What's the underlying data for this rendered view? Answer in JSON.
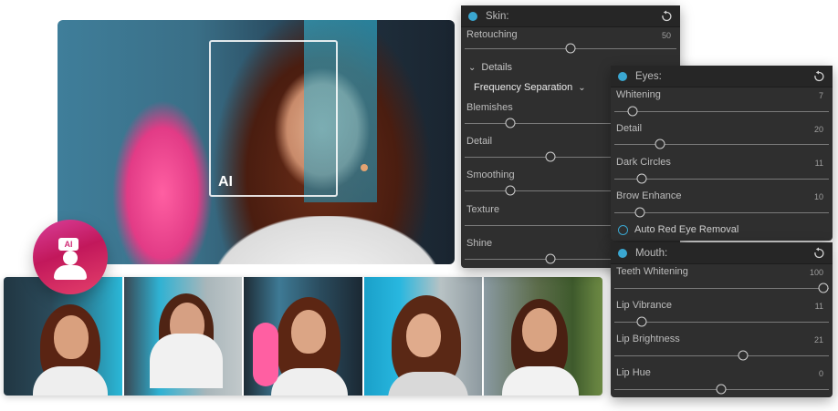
{
  "main_photo": {
    "ai_label": "AI"
  },
  "badge": {
    "tag": "AI"
  },
  "skin_panel": {
    "title": "Skin:",
    "rows_top": [
      {
        "label": "Retouching",
        "value": "50",
        "fraction": 0.47
      }
    ],
    "details_label": "Details",
    "frequency_select": "Frequency Separation",
    "rows_details": [
      {
        "label": "Blemishes",
        "value": "",
        "fraction": 0.21
      },
      {
        "label": "Detail",
        "value": "",
        "fraction": 0.41
      },
      {
        "label": "Smoothing",
        "value": "",
        "fraction": 0.21
      },
      {
        "label": "Texture",
        "value": "",
        "fraction": null
      },
      {
        "label": "Shine",
        "value": "",
        "fraction": 0.41
      }
    ]
  },
  "eyes_panel": {
    "title": "Eyes:",
    "rows": [
      {
        "label": "Whitening",
        "value": "7",
        "fraction": 0.07
      },
      {
        "label": "Detail",
        "value": "20",
        "fraction": 0.2
      },
      {
        "label": "Dark Circles",
        "value": "11",
        "fraction": 0.11
      },
      {
        "label": "Brow Enhance",
        "value": "10",
        "fraction": 0.1
      }
    ],
    "red_eye_label": "Auto Red Eye Removal"
  },
  "mouth_panel": {
    "title": "Mouth:",
    "rows": [
      {
        "label": "Teeth Whitening",
        "value": "100",
        "fraction": 1.0
      },
      {
        "label": "Lip Vibrance",
        "value": "11",
        "fraction": 0.11
      },
      {
        "label": "Lip Brightness",
        "value": "21",
        "fraction": 0.61
      },
      {
        "label": "Lip Hue",
        "value": "0",
        "fraction": 0.5
      }
    ]
  },
  "colors": {
    "panel_bg": "#2f2f2f",
    "accent_dot": "#3aa7d1",
    "badge_pink": "#d12f78"
  },
  "filmstrip": {
    "count": 5
  }
}
